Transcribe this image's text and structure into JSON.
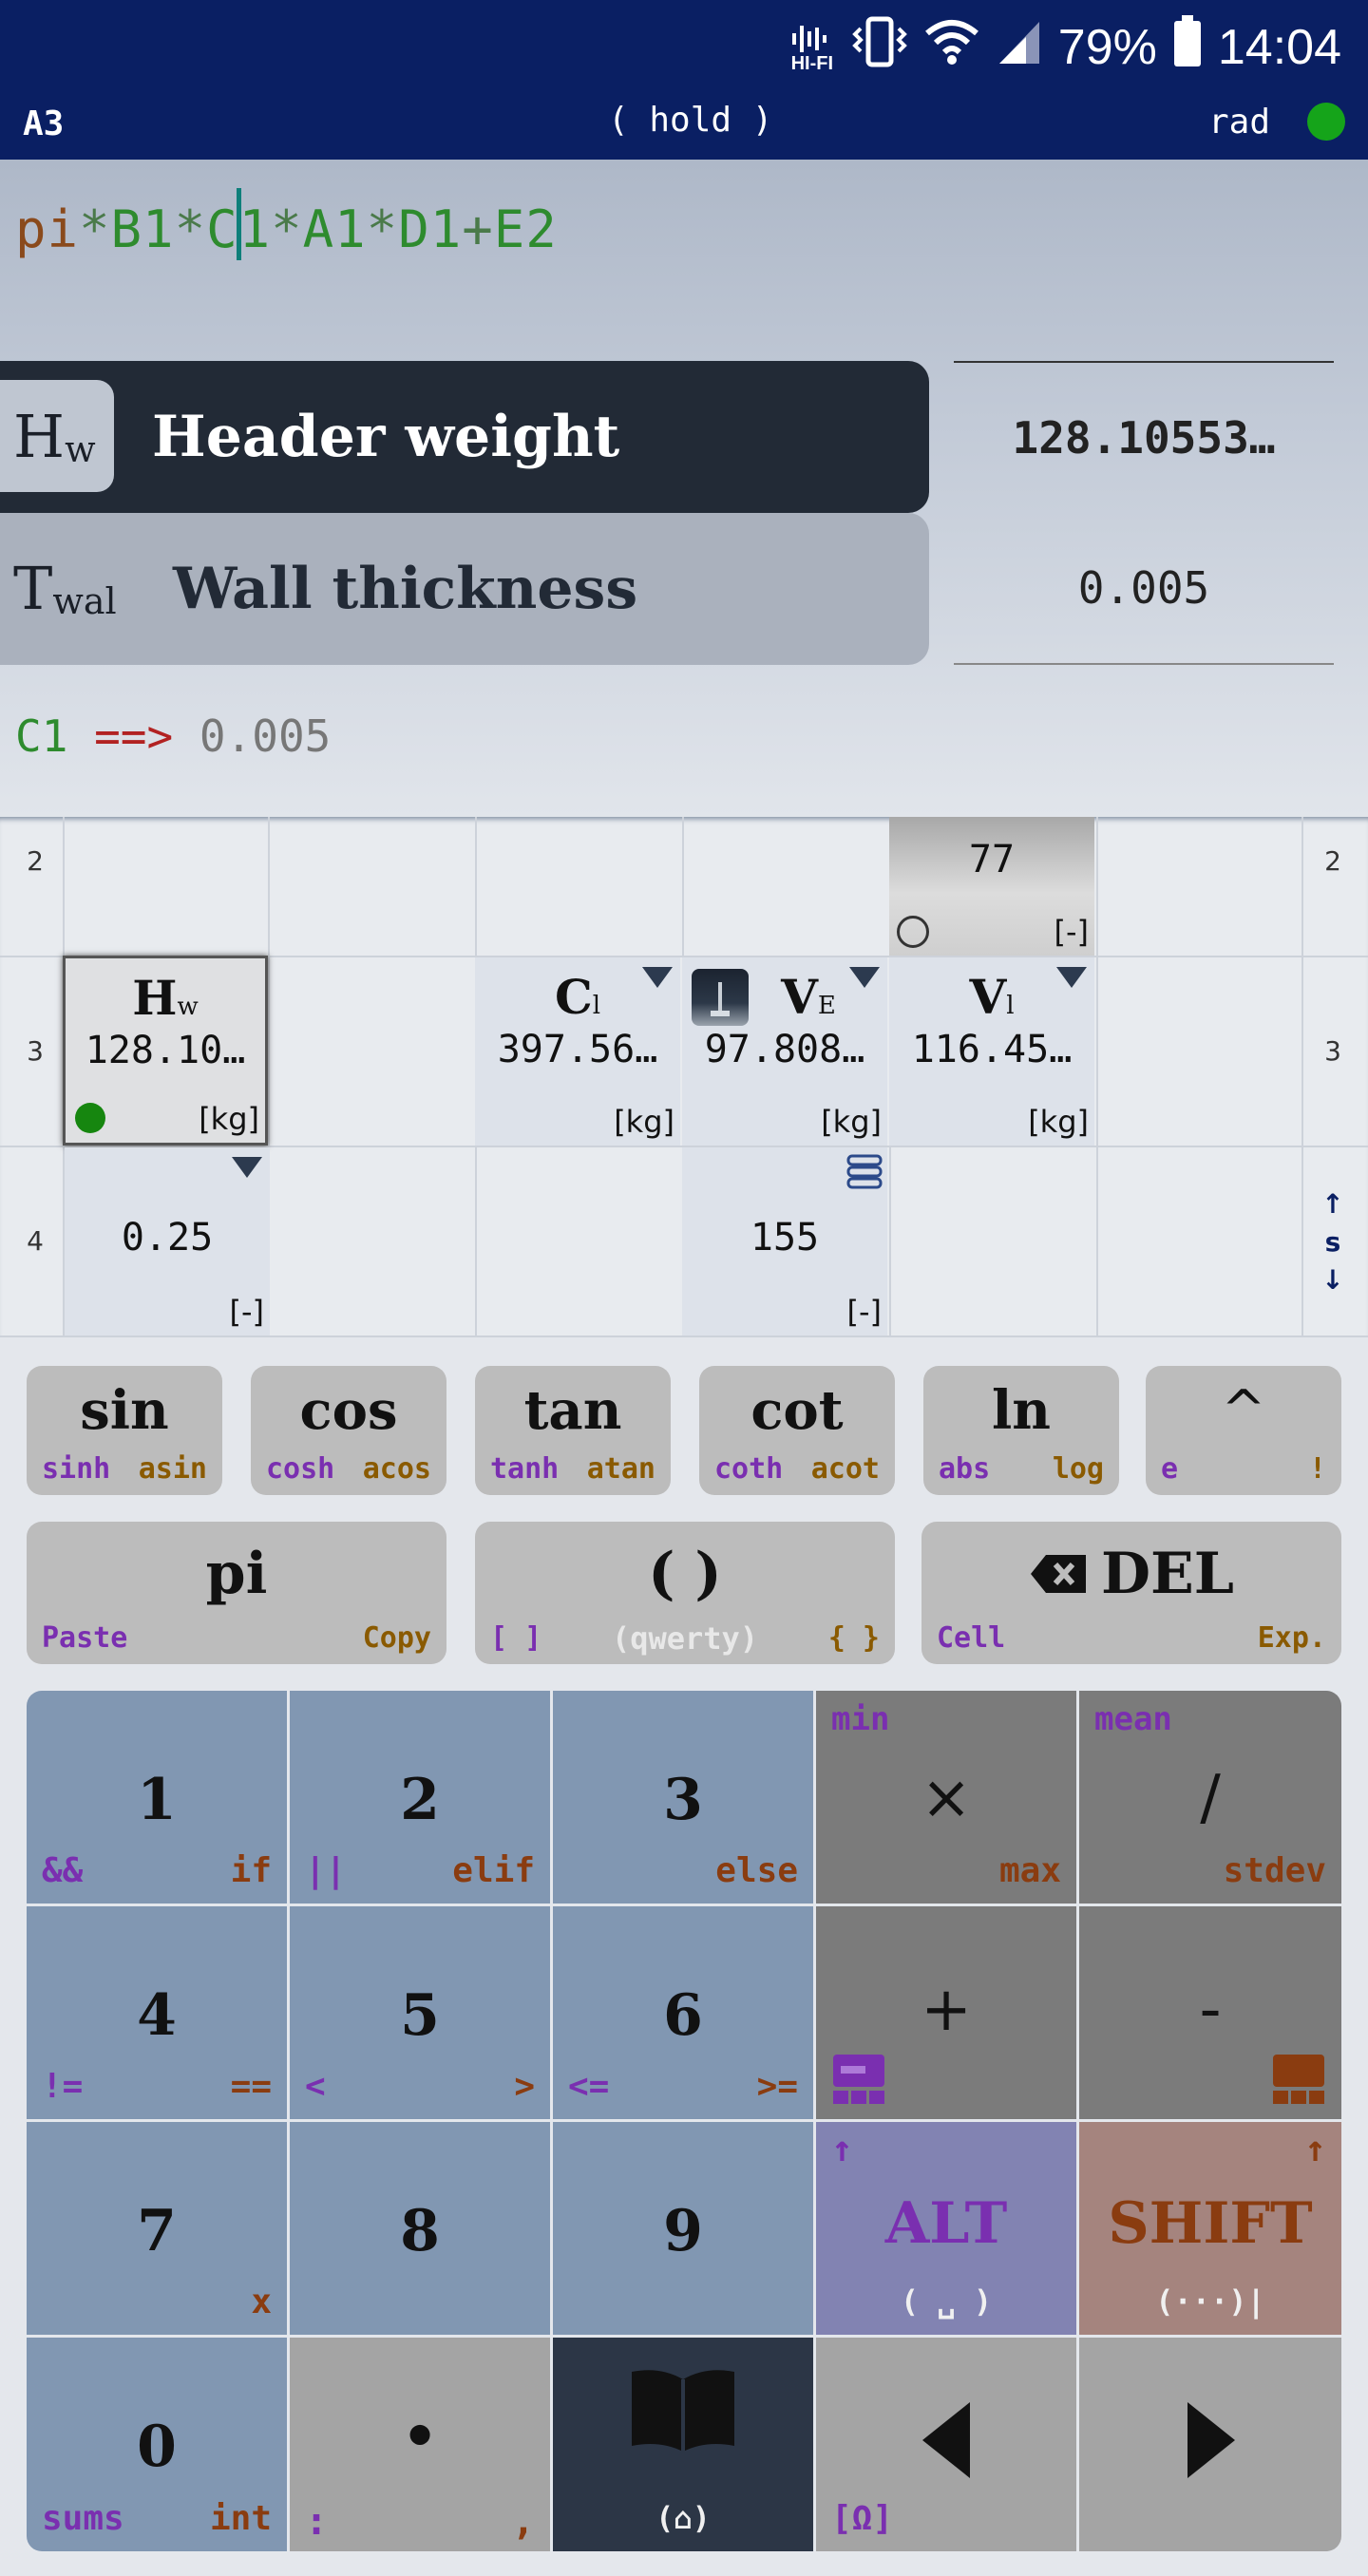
{
  "status_bar": {
    "signal_label": "HI-FI",
    "battery": "79%",
    "time": "14:04"
  },
  "title_row": {
    "cell": "A3",
    "hint": "( hold )",
    "mode": "rad",
    "status_color": "#15a41a"
  },
  "expression": {
    "parts": [
      "pi",
      "*",
      "B1",
      "*",
      "C",
      "1",
      "*",
      "A1",
      "*",
      "D1",
      "+",
      "E2"
    ]
  },
  "suggestions": [
    {
      "sym": "H",
      "sub": "w",
      "name": "Header weight",
      "value": "128.10553…",
      "selected": true
    },
    {
      "sym": "T",
      "sub": "wal",
      "name": "Wall thickness",
      "value": "0.005",
      "selected": false
    }
  ],
  "result": {
    "ref": "C1",
    "arrow": "==>",
    "value": "0.005"
  },
  "grid": {
    "rows": [
      "2",
      "3",
      "4"
    ],
    "scroll": {
      "up": "↑",
      "label": "s",
      "down": "↓"
    },
    "cells": {
      "d2": {
        "value": "77",
        "unit": "[-]"
      },
      "a3": {
        "sym": "H",
        "sub": "w",
        "value": "128.10…",
        "unit": "[kg]"
      },
      "b3": {
        "sym": "C",
        "sub": "l",
        "value": "397.56…",
        "unit": "[kg]"
      },
      "c3": {
        "sym": "V",
        "sub": "E",
        "value": "97.808…",
        "unit": "[kg]"
      },
      "d3": {
        "sym": "V",
        "sub": "l",
        "value": "116.45…",
        "unit": "[kg]"
      },
      "a4": {
        "value": "0.25",
        "unit": "[-]"
      },
      "c4": {
        "value": "155",
        "unit": "[-]"
      }
    }
  },
  "keys": {
    "sin": {
      "main": "sin",
      "left": "sinh",
      "right": "asin"
    },
    "cos": {
      "main": "cos",
      "left": "cosh",
      "right": "acos"
    },
    "tan": {
      "main": "tan",
      "left": "tanh",
      "right": "atan"
    },
    "cot": {
      "main": "cot",
      "left": "coth",
      "right": "acot"
    },
    "ln": {
      "main": "ln",
      "left": "abs",
      "right": "log"
    },
    "pow": {
      "main": "^",
      "left": "e",
      "right": "!"
    },
    "pi": {
      "main": "pi",
      "left": "Paste",
      "right": "Copy"
    },
    "paren": {
      "main": "( )",
      "left": "[ ]",
      "center": "(qwerty)",
      "right": "{ }"
    },
    "del": {
      "main": "DEL",
      "left": "Cell",
      "right": "Exp."
    },
    "k1": {
      "main": "1",
      "left": "&&",
      "right": "if"
    },
    "k2": {
      "main": "2",
      "left": "||",
      "right": "elif"
    },
    "k3": {
      "main": "3",
      "right": "else"
    },
    "kmul": {
      "main": "×",
      "top": "min",
      "right": "max"
    },
    "kdiv": {
      "main": "/",
      "top": "mean",
      "right": "stdev"
    },
    "k4": {
      "main": "4",
      "left": "!=",
      "right": "=="
    },
    "k5": {
      "main": "5",
      "left": "<",
      "right": ">"
    },
    "k6": {
      "main": "6",
      "left": "<=",
      "right": ">="
    },
    "kplus": {
      "main": "+"
    },
    "kminus": {
      "main": "-"
    },
    "k7": {
      "main": "7",
      "right": "x"
    },
    "k8": {
      "main": "8"
    },
    "k9": {
      "main": "9"
    },
    "alt": {
      "main": "ALT",
      "arrow": "↑",
      "sub": "( ␣ )"
    },
    "shift": {
      "main": "SHIFT",
      "arrow": "↑",
      "sub": "(···)|"
    },
    "k0": {
      "main": "0",
      "left": "sums",
      "right": "int"
    },
    "kdot": {
      "main": "•",
      "left": ":",
      "right": ","
    },
    "book": {
      "sub": "(⌂)"
    },
    "left": {
      "left": "[Ω]"
    },
    "right": {}
  }
}
